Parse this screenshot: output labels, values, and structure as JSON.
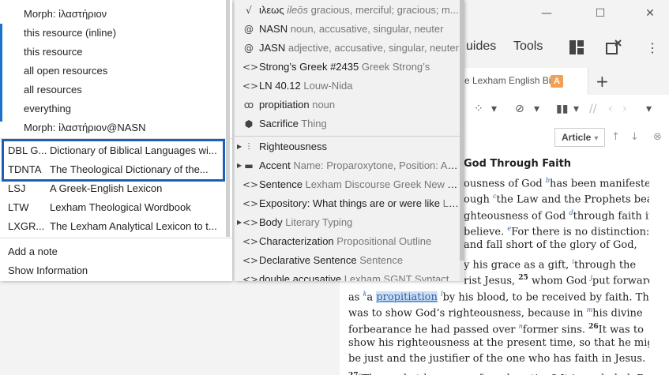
{
  "window": {
    "controls": {
      "minimize": "—",
      "maximize": "☐",
      "close": "✕"
    }
  },
  "toolbar": {
    "guides_label": "uides",
    "tools_label": "Tools",
    "layouts_icon": "layouts-icon",
    "panel_close_icon": "panel-close-icon",
    "more_icon": "more-vertical-icon"
  },
  "tab": {
    "label": "e Lexham English Bible",
    "badge": "A",
    "new_tab": "+"
  },
  "doc_toolbar": {
    "article_label": "Article",
    "article_caret": "▾"
  },
  "document": {
    "heading": "God Through Faith",
    "lines": [
      [
        {
          "t": "ousness of God "
        },
        {
          "f": "b"
        },
        {
          "t": "has been manifested"
        }
      ],
      [
        {
          "t": "ough "
        },
        {
          "f": "c"
        },
        {
          "t": "the Law and the Prophets bear"
        }
      ],
      [
        {
          "t": "ghteousness of God "
        },
        {
          "f": "d"
        },
        {
          "t": "through faith in"
        }
      ],
      [
        {
          "t": " believe. "
        },
        {
          "f": "e"
        },
        {
          "t": "For there is no distinction:"
        }
      ],
      [
        {
          "t": " and fall short of the glory of God,"
        }
      ],
      [
        {
          "t": "y his grace as a gift, "
        },
        {
          "f": "i"
        },
        {
          "t": "through the"
        }
      ],
      [
        {
          "t": "rist Jesus, "
        },
        {
          "v": "25"
        },
        {
          "t": " whom God "
        },
        {
          "f": "j"
        },
        {
          "t": "put forward"
        }
      ],
      [
        {
          "t": "as "
        },
        {
          "f": "k"
        },
        {
          "t": "a "
        },
        {
          "h": "propitiation"
        },
        {
          "t": " "
        },
        {
          "f": "l"
        },
        {
          "t": "by his blood, to be received by faith. This"
        }
      ],
      [
        {
          "t": "was to show God’s righteousness, because in "
        },
        {
          "f": "m"
        },
        {
          "t": "his divine"
        }
      ],
      [
        {
          "t": "forbearance he had passed over "
        },
        {
          "f": "n"
        },
        {
          "t": "former sins. "
        },
        {
          "v": "26"
        },
        {
          "t": "It was to"
        }
      ],
      [
        {
          "t": "show his righteousness at the present time, so that he might"
        }
      ],
      [
        {
          "t": "be just and the justifier of the one who has faith in Jesus."
        }
      ],
      [
        {
          "v": "27"
        },
        {
          "f": "o"
        },
        {
          "t": "Then, what becomes of our boasting? It is excluded. By"
        }
      ]
    ]
  },
  "menu1": {
    "search_items": [
      "Morph: ἱλαστήριον",
      "this resource (inline)",
      "this resource",
      "all open resources",
      "all resources",
      "everything",
      "Morph: ἱλαστήριον@NASN"
    ],
    "resources": [
      {
        "abbr": "DBL G...",
        "name": "Dictionary of Biblical Languages wi..."
      },
      {
        "abbr": "TDNTA",
        "name": "The Theological Dictionary of the..."
      },
      {
        "abbr": "LSJ",
        "name": "A Greek-English Lexicon"
      },
      {
        "abbr": "LTW",
        "name": "Lexham Theological Wordbook"
      },
      {
        "abbr": "LXGR...",
        "name": "The Lexham Analytical Lexicon to t..."
      }
    ],
    "actions": [
      "Add a note",
      "Show Information"
    ]
  },
  "menu2": {
    "items": [
      {
        "icon": "√",
        "icon_name": "root-icon",
        "arrow": false,
        "pri": "ιλεως",
        "it": "ileōs",
        "sec": " gracious, merciful; gracious; m..."
      },
      {
        "icon": "@",
        "icon_name": "morph-icon",
        "arrow": false,
        "pri": "NASN",
        "sec": " noun, accusative, singular, neuter"
      },
      {
        "icon": "@",
        "icon_name": "morph-icon",
        "arrow": false,
        "pri": "JASN",
        "sec": " adjective, accusative, singular, neuter"
      },
      {
        "icon": "<>",
        "icon_name": "reference-icon",
        "arrow": false,
        "pri": "Strong’s Greek #2435",
        "sec": " Greek Strong’s"
      },
      {
        "icon": "<>",
        "icon_name": "reference-icon",
        "arrow": false,
        "pri": "LN 40.12",
        "sec": " Louw-Nida"
      },
      {
        "icon": "ꝏ",
        "icon_name": "sense-icon",
        "arrow": false,
        "pri": "propitiation",
        "sec": " noun"
      },
      {
        "icon": "⬢",
        "icon_name": "thing-icon",
        "arrow": false,
        "pri": "Sacrifice",
        "sec": " Thing"
      },
      {
        "icon": "⫶",
        "icon_name": "pillar-icon",
        "arrow": true,
        "pri": "Righteousness",
        "sec": ""
      },
      {
        "icon": "▬",
        "icon_name": "tag-icon",
        "arrow": true,
        "pri": "Accent",
        "sec": " Name: Proparoxytone, Position: An..."
      },
      {
        "icon": "<>",
        "icon_name": "reference-icon",
        "arrow": false,
        "pri": "Sentence",
        "sec": " Lexham Discourse Greek New Te..."
      },
      {
        "icon": "<>",
        "icon_name": "reference-icon",
        "arrow": false,
        "pri": "Expository: What things are or were like",
        "sec": " Lo..."
      },
      {
        "icon": "<>",
        "icon_name": "reference-icon",
        "arrow": true,
        "pri": "Body",
        "sec": " Literary Typing"
      },
      {
        "icon": "<>",
        "icon_name": "reference-icon",
        "arrow": false,
        "pri": "Characterization",
        "sec": " Propositional Outline"
      },
      {
        "icon": "<>",
        "icon_name": "reference-icon",
        "arrow": false,
        "pri": "Declarative Sentence",
        "sec": " Sentence"
      },
      {
        "icon": "<>",
        "icon_name": "reference-icon",
        "arrow": false,
        "pri": "double accusative",
        "sec": " Lexham SGNT Syntactic..."
      }
    ]
  }
}
